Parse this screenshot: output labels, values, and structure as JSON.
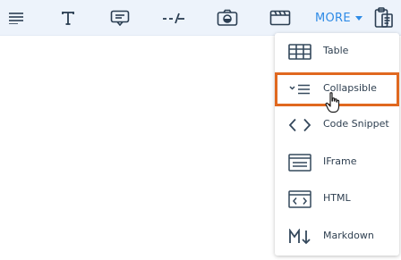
{
  "toolbar": {
    "icons": [
      "paragraph-icon",
      "text-icon",
      "comment-box-icon",
      "divider-icon",
      "camera-icon",
      "video-icon",
      "clipboard-icon"
    ],
    "more_label": "MORE",
    "accent": "#2f8be6"
  },
  "menu": {
    "items": [
      {
        "label": "Table",
        "icon": "table-icon"
      },
      {
        "label": "Collapsible",
        "icon": "collapsible-icon"
      },
      {
        "label": "Code Snippet",
        "icon": "code-icon"
      },
      {
        "label": "IFrame",
        "icon": "iframe-icon"
      },
      {
        "label": "HTML",
        "icon": "html-icon"
      },
      {
        "label": "Markdown",
        "icon": "markdown-icon"
      }
    ],
    "highlight_color": "#e0681f"
  }
}
